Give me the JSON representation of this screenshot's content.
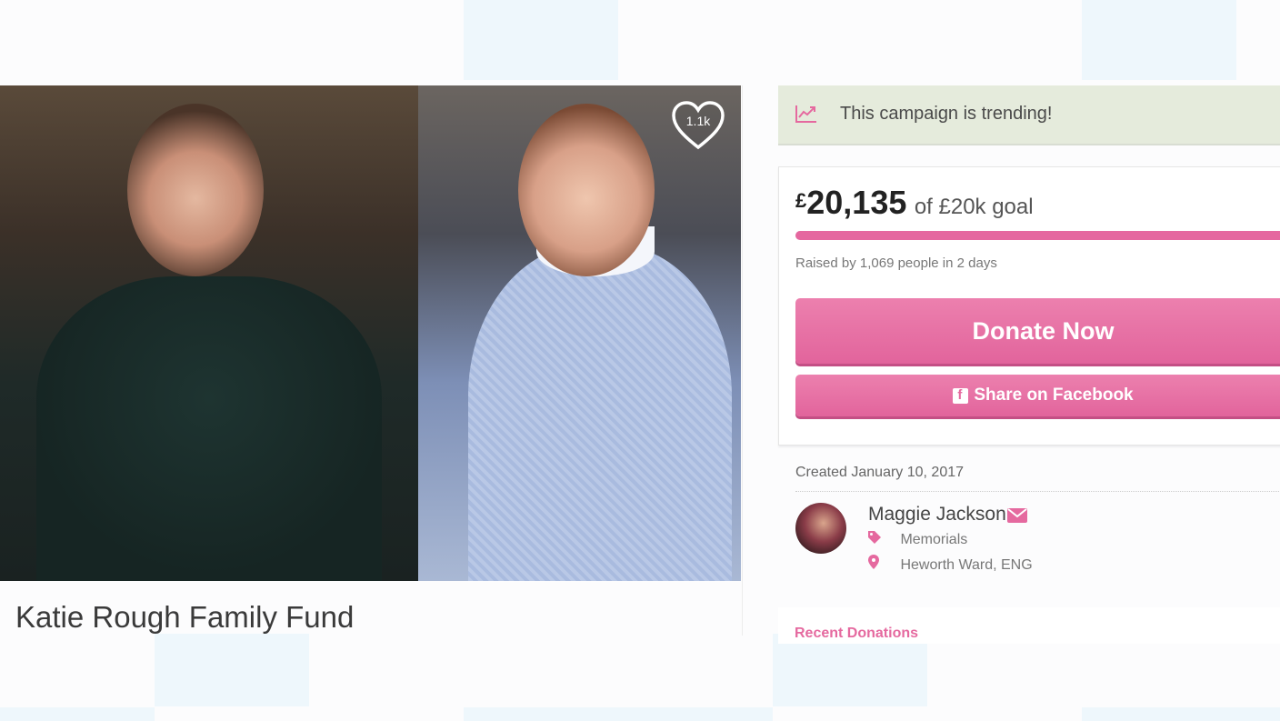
{
  "campaign": {
    "title": "Katie Rough Family Fund",
    "likes": "1.1k"
  },
  "trending": {
    "text": "This campaign is trending!"
  },
  "funding": {
    "currency": "£",
    "amount": "20,135",
    "goal_text": "of £20k goal",
    "progress_fraction": 1.0,
    "raised_text": "Raised by 1,069 people in 2 days"
  },
  "buttons": {
    "donate": "Donate Now",
    "share": "Share on Facebook"
  },
  "meta": {
    "created": "Created January 10, 2017",
    "organizer": "Maggie Jackson",
    "category": "Memorials",
    "location": "Heworth Ward, ENG"
  },
  "recent_donations": {
    "label": "Recent Donations"
  },
  "colors": {
    "accent": "#e5699f",
    "trending_bg": "#e5ebdc"
  }
}
